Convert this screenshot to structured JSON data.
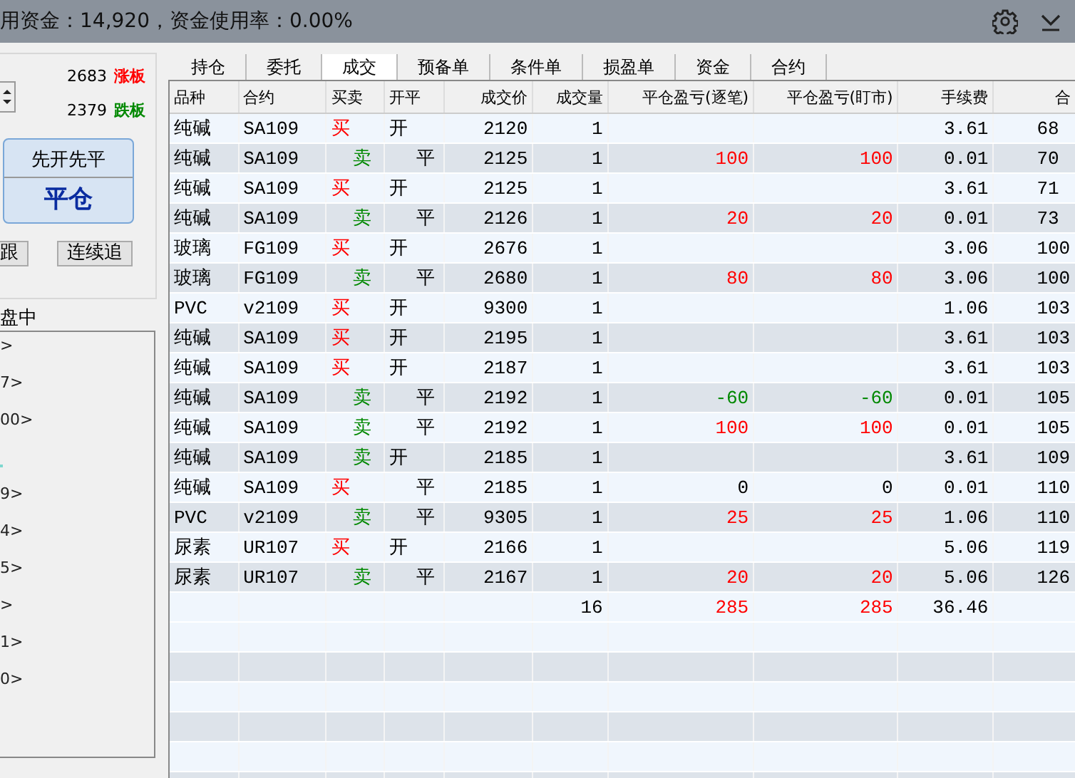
{
  "top_bar": {
    "funds_text": "用资金：14,920，资金使用率：0.00%"
  },
  "order_panel": {
    "limit_up": {
      "price": "2683",
      "label": "涨板"
    },
    "limit_down": {
      "price": "2379",
      "label": "跌板"
    },
    "mode_button": {
      "title": "先开先平",
      "action": "平仓"
    },
    "buttons": [
      "跟",
      "连续追"
    ],
    "list_title": "盘中",
    "list_items": [
      {
        "kind": "text",
        "text": ">"
      },
      {
        "kind": "text",
        "text": "7>"
      },
      {
        "kind": "text",
        "text": "00>"
      },
      {
        "kind": "mark"
      },
      {
        "kind": "text",
        "text": "9>"
      },
      {
        "kind": "text",
        "text": "4>"
      },
      {
        "kind": "text",
        "text": "5>"
      },
      {
        "kind": "text",
        "text": ">"
      },
      {
        "kind": "text",
        "text": "1>"
      },
      {
        "kind": "text",
        "text": "0>"
      }
    ]
  },
  "tabs": [
    {
      "label": "持仓",
      "selected": false
    },
    {
      "label": "委托",
      "selected": false
    },
    {
      "label": "成交",
      "selected": true
    },
    {
      "label": "预备单",
      "selected": false
    },
    {
      "label": "条件单",
      "selected": false
    },
    {
      "label": "损盈单",
      "selected": false
    },
    {
      "label": "资金",
      "selected": false
    },
    {
      "label": "合约",
      "selected": false
    }
  ],
  "table": {
    "columns": [
      "品种",
      "合约",
      "买卖",
      "开平",
      "成交价",
      "成交量",
      "平仓盈亏(逐笔)",
      "平仓盈亏(盯市)",
      "手续费",
      "合"
    ],
    "rows": [
      {
        "product": "纯碱",
        "contract": "SA109",
        "buy": true,
        "side_text": "买",
        "close": false,
        "offset_text": "开",
        "price": "2120",
        "qty": "1",
        "kind": "flat",
        "fee": "3.61",
        "column_10": "68"
      },
      {
        "product": "纯碱",
        "contract": "SA109",
        "buy": false,
        "side_text": "卖",
        "close": true,
        "offset_text": "平",
        "price": "2125",
        "qty": "1",
        "pnl_trade": "100",
        "pnl_mark": "100",
        "kind": "profit",
        "fee": "0.01",
        "column_10": "70"
      },
      {
        "product": "纯碱",
        "contract": "SA109",
        "buy": true,
        "side_text": "买",
        "close": false,
        "offset_text": "开",
        "price": "2125",
        "qty": "1",
        "kind": "flat",
        "fee": "3.61",
        "column_10": "71"
      },
      {
        "product": "纯碱",
        "contract": "SA109",
        "buy": false,
        "side_text": "卖",
        "close": true,
        "offset_text": "平",
        "price": "2126",
        "qty": "1",
        "pnl_trade": "20",
        "pnl_mark": "20",
        "kind": "profit",
        "fee": "0.01",
        "column_10": "73"
      },
      {
        "product": "玻璃",
        "contract": "FG109",
        "buy": true,
        "side_text": "买",
        "close": false,
        "offset_text": "开",
        "price": "2676",
        "qty": "1",
        "kind": "flat",
        "fee": "3.06",
        "column_10": "100"
      },
      {
        "product": "玻璃",
        "contract": "FG109",
        "buy": false,
        "side_text": "卖",
        "close": true,
        "offset_text": "平",
        "price": "2680",
        "qty": "1",
        "pnl_trade": "80",
        "pnl_mark": "80",
        "kind": "profit",
        "fee": "3.06",
        "column_10": "100"
      },
      {
        "product": "PVC",
        "contract": "v2109",
        "buy": true,
        "side_text": "买",
        "close": false,
        "offset_text": "开",
        "price": "9300",
        "qty": "1",
        "kind": "flat",
        "fee": "1.06",
        "column_10": "103"
      },
      {
        "product": "纯碱",
        "contract": "SA109",
        "buy": true,
        "side_text": "买",
        "close": false,
        "offset_text": "开",
        "price": "2195",
        "qty": "1",
        "kind": "flat",
        "fee": "3.61",
        "column_10": "103"
      },
      {
        "product": "纯碱",
        "contract": "SA109",
        "buy": true,
        "side_text": "买",
        "close": false,
        "offset_text": "开",
        "price": "2187",
        "qty": "1",
        "kind": "flat",
        "fee": "3.61",
        "column_10": "103"
      },
      {
        "product": "纯碱",
        "contract": "SA109",
        "buy": false,
        "side_text": "卖",
        "close": true,
        "offset_text": "平",
        "price": "2192",
        "qty": "1",
        "pnl_trade": "-60",
        "pnl_mark": "-60",
        "kind": "loss",
        "fee": "0.01",
        "column_10": "105"
      },
      {
        "product": "纯碱",
        "contract": "SA109",
        "buy": false,
        "side_text": "卖",
        "close": true,
        "offset_text": "平",
        "price": "2192",
        "qty": "1",
        "pnl_trade": "100",
        "pnl_mark": "100",
        "kind": "profit",
        "fee": "0.01",
        "column_10": "105"
      },
      {
        "product": "纯碱",
        "contract": "SA109",
        "buy": false,
        "side_text": "卖",
        "close": false,
        "offset_text": "开",
        "price": "2185",
        "qty": "1",
        "kind": "flat",
        "fee": "3.61",
        "column_10": "109"
      },
      {
        "product": "纯碱",
        "contract": "SA109",
        "buy": true,
        "side_text": "买",
        "close": true,
        "offset_text": "平",
        "price": "2185",
        "qty": "1",
        "pnl_trade": "0",
        "pnl_mark": "0",
        "kind": "flat",
        "fee": "0.01",
        "column_10": "110"
      },
      {
        "product": "PVC",
        "contract": "v2109",
        "buy": false,
        "side_text": "卖",
        "close": true,
        "offset_text": "平",
        "price": "9305",
        "qty": "1",
        "pnl_trade": "25",
        "pnl_mark": "25",
        "kind": "profit",
        "fee": "1.06",
        "column_10": "110"
      },
      {
        "product": "尿素",
        "contract": "UR107",
        "buy": true,
        "side_text": "买",
        "close": false,
        "offset_text": "开",
        "price": "2166",
        "qty": "1",
        "kind": "flat",
        "fee": "5.06",
        "column_10": "119"
      },
      {
        "product": "尿素",
        "contract": "UR107",
        "buy": false,
        "side_text": "卖",
        "close": true,
        "offset_text": "平",
        "price": "2167",
        "qty": "1",
        "pnl_trade": "20",
        "pnl_mark": "20",
        "kind": "profit",
        "fee": "5.06",
        "column_10": "126"
      }
    ],
    "total": {
      "qty": "16",
      "pnl_trade": "285",
      "pnl_mark": "285",
      "kind": "profit",
      "fee": "36.46"
    }
  }
}
